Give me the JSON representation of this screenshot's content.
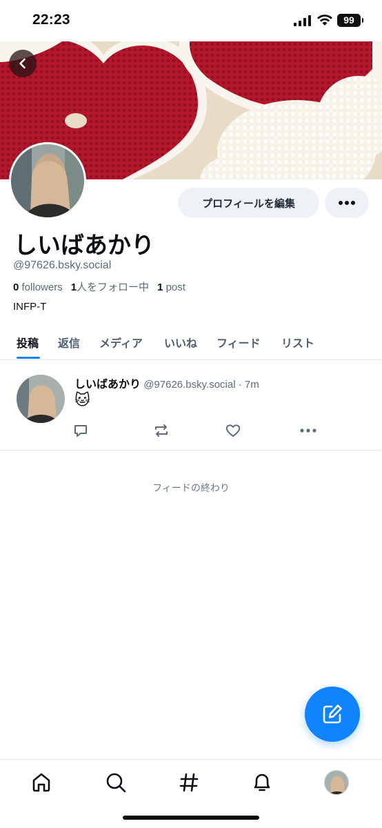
{
  "status_bar": {
    "time": "22:23",
    "battery": "99"
  },
  "profile": {
    "display_name": "しいばあかり",
    "handle": "@97626.bsky.social",
    "followers_count": "0",
    "followers_label": "followers",
    "following_count": "1",
    "following_label": "人をフォロー中",
    "posts_count": "1",
    "posts_label": "post",
    "bio": "INFP-T",
    "edit_button_label": "プロフィールを編集"
  },
  "tabs": [
    {
      "label": "投稿",
      "active": true
    },
    {
      "label": "返信"
    },
    {
      "label": "メディア"
    },
    {
      "label": "いいね"
    },
    {
      "label": "フィード"
    },
    {
      "label": "リスト"
    }
  ],
  "posts": [
    {
      "author_name": "しいばあかり",
      "author_handle": "@97626.bsky.social",
      "separator": "·",
      "time": "7m",
      "content": "🐱"
    }
  ],
  "feed_end_text": "フィードの終わり",
  "icons": {
    "back": "chevron-left-icon",
    "more": "ellipsis-icon",
    "reply": "reply-icon",
    "repost": "repost-icon",
    "like": "heart-icon",
    "compose": "compose-icon",
    "home": "home-icon",
    "search": "search-icon",
    "feeds": "hashtag-icon",
    "notifications": "bell-icon"
  },
  "colors": {
    "accent": "#1083fe",
    "banner_red": "#b4172b",
    "banner_white": "#f5f2e8"
  }
}
